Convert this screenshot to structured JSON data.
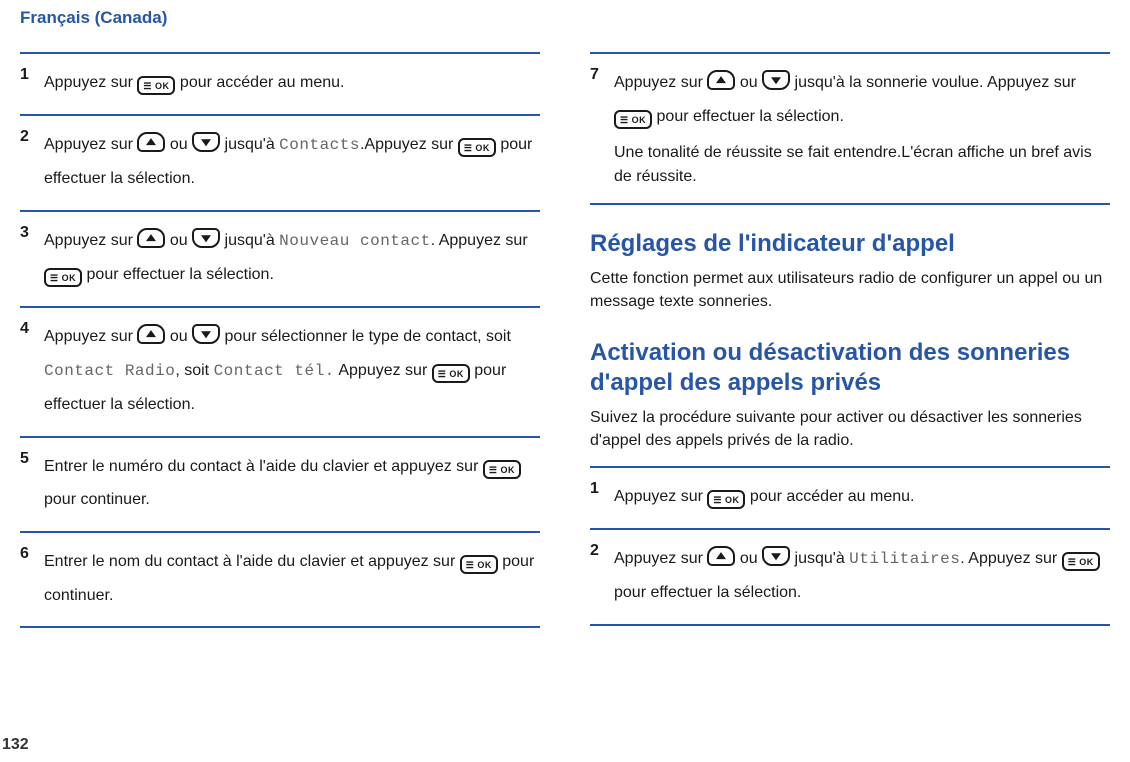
{
  "header": "Français (Canada)",
  "page_number": "132",
  "buttons": {
    "ok_text": "OK"
  },
  "left": {
    "steps": [
      {
        "num": "1",
        "parts": [
          {
            "t": "text",
            "v": "Appuyez sur "
          },
          {
            "t": "ok"
          },
          {
            "t": "text",
            "v": " pour accéder au menu."
          }
        ]
      },
      {
        "num": "2",
        "parts": [
          {
            "t": "text",
            "v": "Appuyez sur "
          },
          {
            "t": "up"
          },
          {
            "t": "text",
            "v": " ou "
          },
          {
            "t": "down"
          },
          {
            "t": "text",
            "v": " jusqu'à "
          },
          {
            "t": "mono",
            "v": "Contacts"
          },
          {
            "t": "text",
            "v": ".Appuyez sur "
          },
          {
            "t": "ok"
          },
          {
            "t": "text",
            "v": " pour effectuer la sélection."
          }
        ]
      },
      {
        "num": "3",
        "parts": [
          {
            "t": "text",
            "v": "Appuyez sur "
          },
          {
            "t": "up"
          },
          {
            "t": "text",
            "v": " ou "
          },
          {
            "t": "down"
          },
          {
            "t": "text",
            "v": " jusqu'à "
          },
          {
            "t": "mono",
            "v": "Nouveau contact"
          },
          {
            "t": "text",
            "v": ". Appuyez sur "
          },
          {
            "t": "ok"
          },
          {
            "t": "text",
            "v": " pour effectuer la sélection."
          }
        ]
      },
      {
        "num": "4",
        "parts": [
          {
            "t": "text",
            "v": "Appuyez sur "
          },
          {
            "t": "up"
          },
          {
            "t": "text",
            "v": " ou "
          },
          {
            "t": "down"
          },
          {
            "t": "text",
            "v": " pour sélectionner le type de contact, soit "
          },
          {
            "t": "mono",
            "v": "Contact Radio"
          },
          {
            "t": "text",
            "v": ", soit "
          },
          {
            "t": "mono",
            "v": "Contact tél."
          },
          {
            "t": "text",
            "v": " Appuyez sur "
          },
          {
            "t": "ok"
          },
          {
            "t": "text",
            "v": " pour effectuer la sélection."
          }
        ]
      },
      {
        "num": "5",
        "parts": [
          {
            "t": "text",
            "v": "Entrer le numéro du contact à l'aide du clavier et appuyez sur "
          },
          {
            "t": "ok"
          },
          {
            "t": "text",
            "v": " pour continuer."
          }
        ]
      },
      {
        "num": "6",
        "parts": [
          {
            "t": "text",
            "v": "Entrer le nom du contact à l'aide du clavier et appuyez sur "
          },
          {
            "t": "ok"
          },
          {
            "t": "text",
            "v": " pour continuer."
          }
        ]
      }
    ]
  },
  "right": {
    "continue_step": {
      "num": "7",
      "blocks": [
        {
          "parts": [
            {
              "t": "text",
              "v": "Appuyez sur "
            },
            {
              "t": "up"
            },
            {
              "t": "text",
              "v": " ou "
            },
            {
              "t": "down"
            },
            {
              "t": "text",
              "v": " jusqu'à la sonnerie voulue. Appuyez sur "
            },
            {
              "t": "ok"
            },
            {
              "t": "text",
              "v": " pour effectuer la sélection."
            }
          ]
        },
        {
          "parts": [
            {
              "t": "text",
              "v": "Une tonalité de réussite se fait entendre.L'écran affiche un bref avis de réussite."
            }
          ]
        }
      ]
    },
    "section1_heading": "Réglages de l'indicateur d'appel",
    "section1_para": "Cette fonction permet aux utilisateurs radio de configurer un appel ou un message texte sonneries.",
    "section2_heading": "Activation ou désactivation des sonneries d'appel des appels privés",
    "section2_para": "Suivez la procédure suivante pour activer ou désactiver les sonneries d'appel des appels privés de la radio.",
    "steps2": [
      {
        "num": "1",
        "parts": [
          {
            "t": "text",
            "v": "Appuyez sur "
          },
          {
            "t": "ok"
          },
          {
            "t": "text",
            "v": " pour accéder au menu."
          }
        ]
      },
      {
        "num": "2",
        "parts": [
          {
            "t": "text",
            "v": "Appuyez sur "
          },
          {
            "t": "up"
          },
          {
            "t": "text",
            "v": " ou "
          },
          {
            "t": "down"
          },
          {
            "t": "text",
            "v": " jusqu'à "
          },
          {
            "t": "mono",
            "v": "Utilitaires"
          },
          {
            "t": "text",
            "v": ". Appuyez sur "
          },
          {
            "t": "ok"
          },
          {
            "t": "text",
            "v": " pour effectuer la sélection."
          }
        ]
      }
    ]
  }
}
